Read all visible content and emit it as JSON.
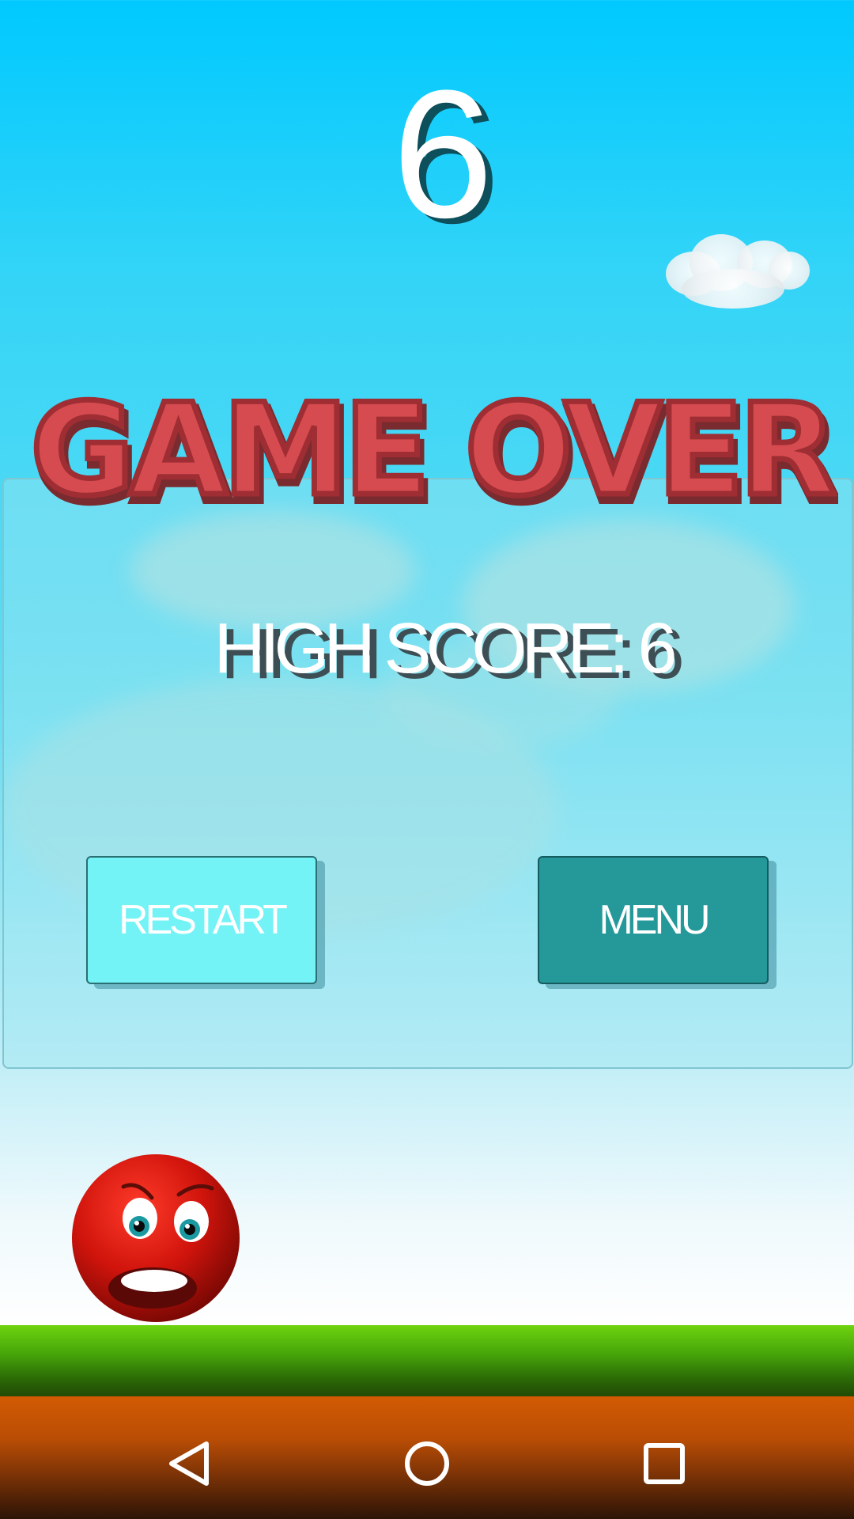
{
  "hud": {
    "score": "6"
  },
  "game_over": {
    "title": "GAME OVER",
    "high_score_label": "HIGH SCORE: 6"
  },
  "buttons": {
    "restart_label": "RESTART",
    "menu_label": "MENU"
  },
  "colors": {
    "sky_top": "#00c9ff",
    "title_red": "#d64b4f",
    "title_outline": "#9e2e33",
    "restart_bg": "#73f3f6",
    "menu_bg": "#25989a",
    "grass": "#46a60a",
    "dirt": "#d25a03"
  },
  "character": {
    "name": "red-ball-character",
    "expression": "angry-scared"
  },
  "navigation": {
    "back": "back-icon",
    "home": "home-icon",
    "recents": "recents-icon"
  }
}
